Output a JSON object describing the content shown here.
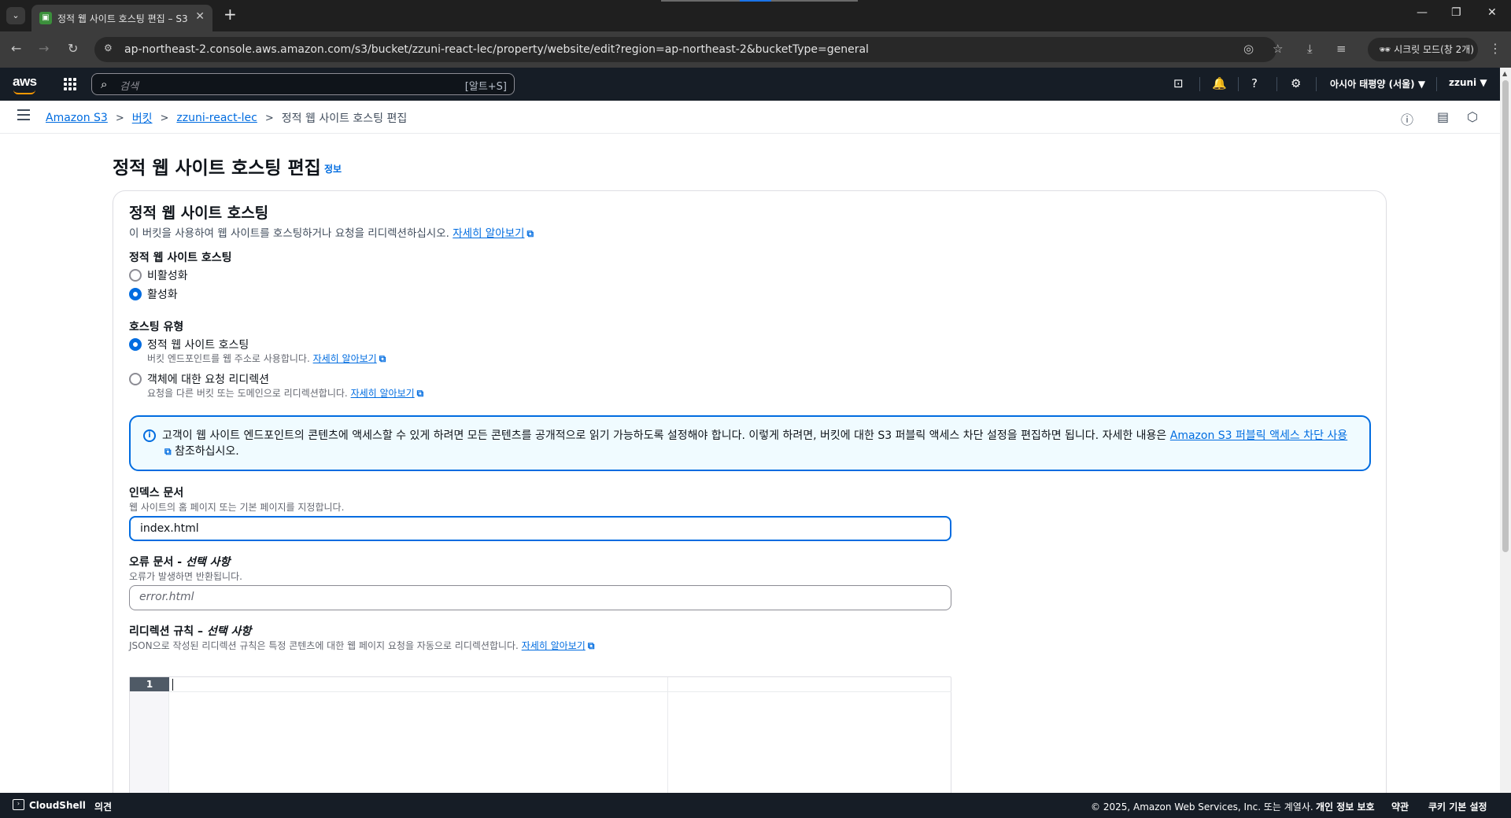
{
  "browser": {
    "tab_title": "정적 웹 사이트 호스팅 편집 – S3",
    "url": "ap-northeast-2.console.aws.amazon.com/s3/bucket/zzuni-react-lec/property/website/edit?region=ap-northeast-2&bucketType=general",
    "incognito_label": "시크릿 모드(창 2개)"
  },
  "aws_nav": {
    "logo": "aws",
    "search_placeholder": "검색",
    "search_shortcut": "[알트+S]",
    "region": "아시아 태평양 (서울) ▼",
    "user": "zzuni ▼"
  },
  "breadcrumb": {
    "items": [
      "Amazon S3",
      "버킷",
      "zzuni-react-lec"
    ],
    "current": "정적 웹 사이트 호스팅 편집"
  },
  "page": {
    "title": "정적 웹 사이트 호스팅 편집",
    "info_label": "정보"
  },
  "section": {
    "title": "정적 웹 사이트 호스팅",
    "description": "이 버킷을 사용하여 웹 사이트를 호스팅하거나 요청을 리디렉션하십시오.",
    "learn_more": "자세히 알아보기"
  },
  "hosting_toggle": {
    "label": "정적 웹 사이트 호스팅",
    "options": [
      "비활성화",
      "활성화"
    ],
    "selected": "활성화"
  },
  "hosting_type": {
    "label": "호스팅 유형",
    "options": [
      {
        "label": "정적 웹 사이트 호스팅",
        "description": "버킷 엔드포인트를 웹 주소로 사용합니다.",
        "link": "자세히 알아보기"
      },
      {
        "label": "객체에 대한 요청 리디렉션",
        "description": "요청을 다른 버킷 또는 도메인으로 리디렉션합니다.",
        "link": "자세히 알아보기"
      }
    ],
    "selected": "정적 웹 사이트 호스팅"
  },
  "alert": {
    "text_before": "고객이 웹 사이트 엔드포인트의 콘텐츠에 액세스할 수 있게 하려면 모든 콘텐츠를 공개적으로 읽기 가능하도록 설정해야 합니다. 이렇게 하려면, 버킷에 대한 S3 퍼블릭 액세스 차단 설정을 편집하면 됩니다. 자세한 내용은 ",
    "link": "Amazon S3 퍼블릭 액세스 차단 사용",
    "text_after": " 참조하십시오."
  },
  "index_doc": {
    "label": "인덱스 문서",
    "description": "웹 사이트의 홈 페이지 또는 기본 페이지를 지정합니다.",
    "value": "index.html"
  },
  "error_doc": {
    "label": "오류 문서 - ",
    "optional": "선택 사항",
    "description": "오류가 발생하면 반환됩니다.",
    "placeholder": "error.html"
  },
  "redirect_rules": {
    "label": "리디렉션 규칙 – ",
    "optional": "선택 사항",
    "description": "JSON으로 작성된 리디렉션 규칙은 특정 콘텐츠에 대한 웹 페이지 요청을 자동으로 리디렉션합니다.",
    "link": "자세히 알아보기",
    "line_number": "1"
  },
  "footer": {
    "cloudshell": "CloudShell",
    "feedback": "의견",
    "copyright": "© 2025, Amazon Web Services, Inc. 또는 계열사.",
    "privacy": "개인 정보 보호",
    "terms": "약관",
    "cookies": "쿠키 기본 설정"
  }
}
